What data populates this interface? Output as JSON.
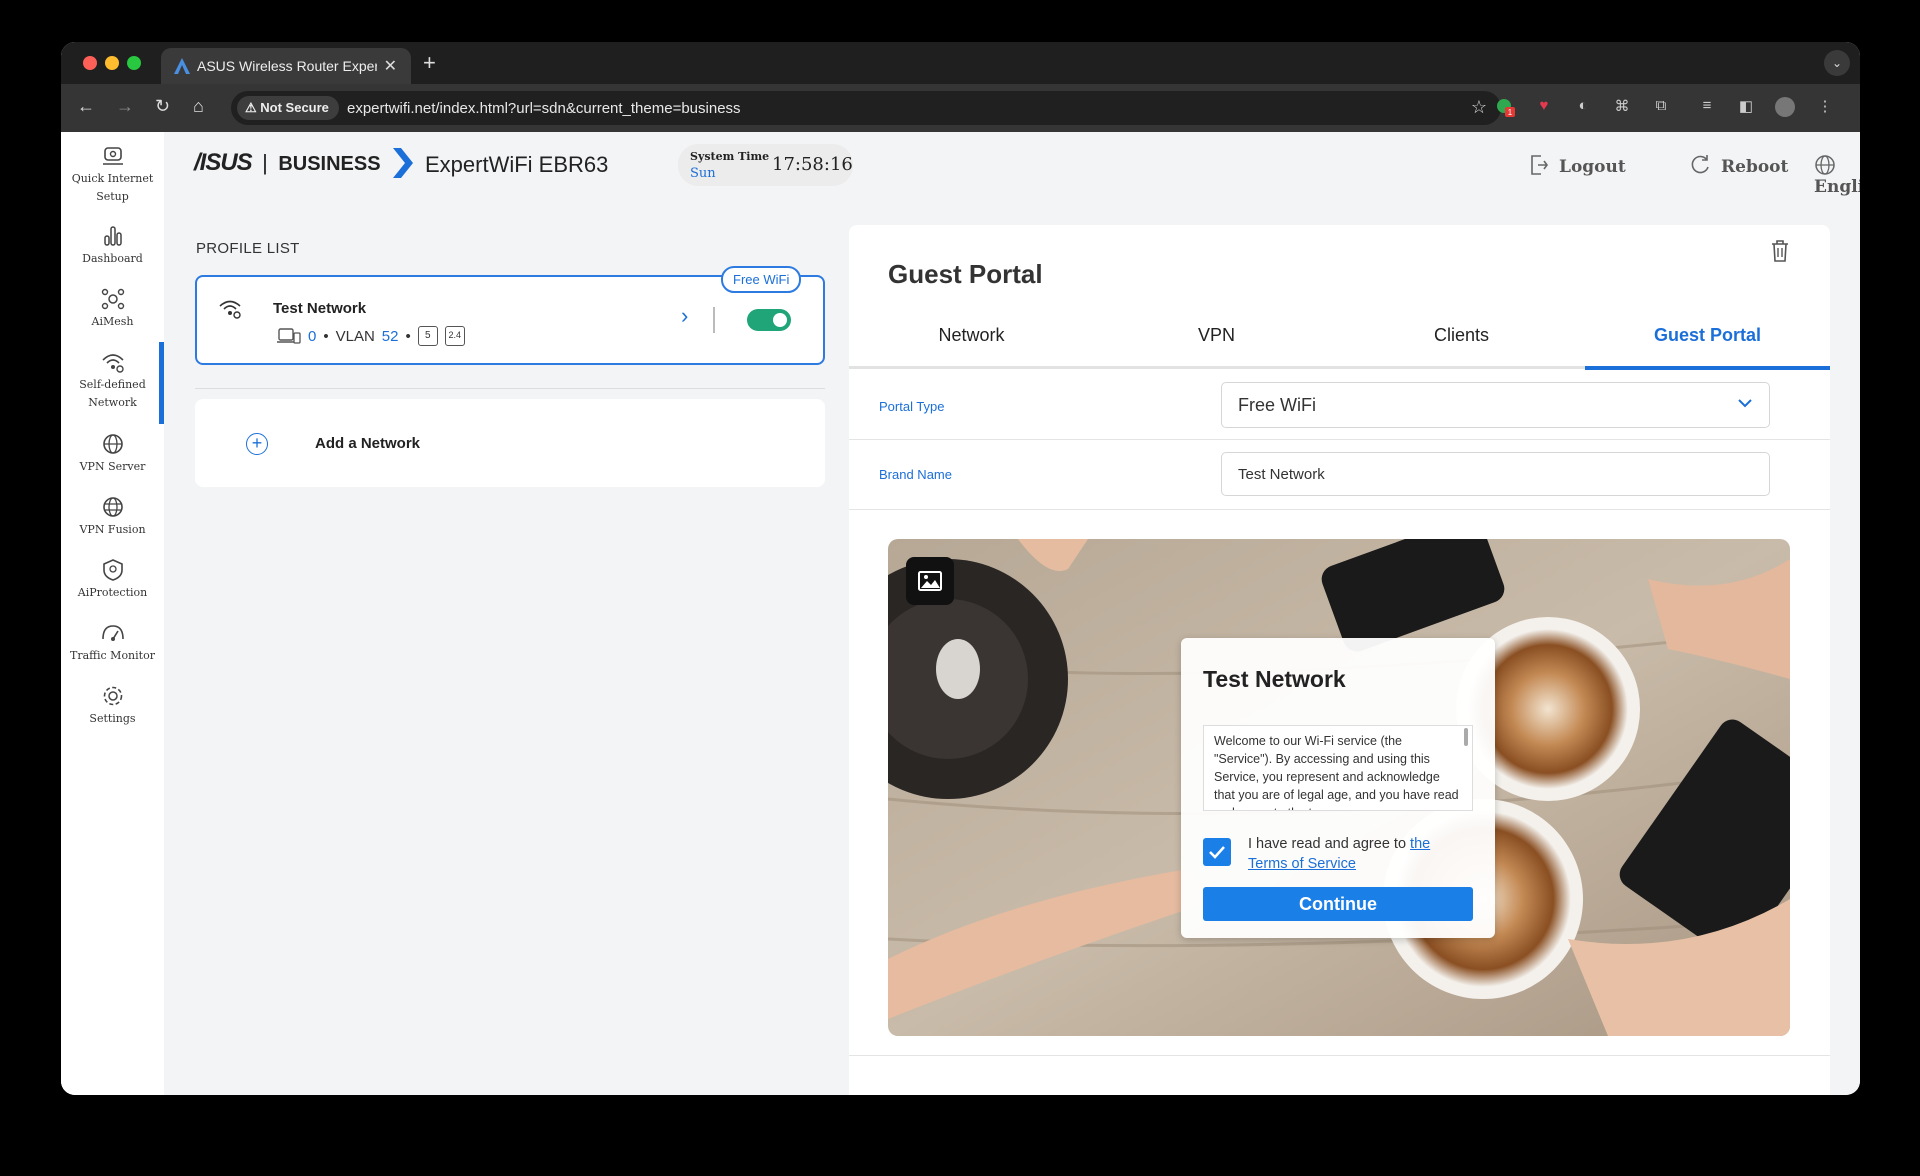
{
  "browser": {
    "tab_title": "ASUS Wireless Router Exper",
    "new_tab": "+",
    "security_label": "Not Secure",
    "url": "expertwifi.net/index.html?url=sdn&current_theme=business",
    "ext_badge": "1"
  },
  "sidebar": {
    "items": [
      {
        "label": "Quick Internet Setup",
        "icon": "quick-setup-icon"
      },
      {
        "label": "Dashboard",
        "icon": "dashboard-icon"
      },
      {
        "label": "AiMesh",
        "icon": "aimesh-icon"
      },
      {
        "label": "Self-defined Network",
        "icon": "sdn-icon"
      },
      {
        "label": "VPN Server",
        "icon": "vpn-server-icon"
      },
      {
        "label": "VPN Fusion",
        "icon": "vpn-fusion-icon"
      },
      {
        "label": "AiProtection",
        "icon": "aiprotection-icon"
      },
      {
        "label": "Traffic Monitor",
        "icon": "traffic-monitor-icon"
      },
      {
        "label": "Settings",
        "icon": "settings-icon"
      }
    ]
  },
  "header": {
    "brand": "/ISUS",
    "brand_sep": "|",
    "brand_business": "BUSINESS",
    "model": "ExpertWiFi EBR63",
    "system_time_label": "System Time",
    "day": "Sun",
    "time": "17:58:16",
    "logout": "Logout",
    "reboot": "Reboot",
    "language": "English"
  },
  "profile_list": {
    "title": "PROFILE LIST",
    "profiles": [
      {
        "name": "Test Network",
        "badge": "Free WiFi",
        "clients": "0",
        "dot": "•",
        "vlan_label": "VLAN",
        "vlan": "52",
        "band_5": "5",
        "band_24": "2.4",
        "enabled": true
      }
    ],
    "add_label": "Add a Network"
  },
  "panel": {
    "title": "Guest Portal",
    "tabs": [
      "Network",
      "VPN",
      "Clients",
      "Guest Portal"
    ],
    "active_tab": "Guest Portal",
    "portal_type_label": "Portal Type",
    "portal_type_value": "Free WiFi",
    "brand_name_label": "Brand Name",
    "brand_name_value": "Test Network"
  },
  "preview": {
    "title": "Test Network",
    "tos_text": "Welcome to our Wi-Fi service (the \"Service\"). By accessing and using this Service, you represent and acknowledge that you are of legal age, and you have read and agree to the terms...",
    "agree_prefix": "I have read and agree to",
    "agree_link": "the Terms of Service",
    "continue": "Continue"
  }
}
